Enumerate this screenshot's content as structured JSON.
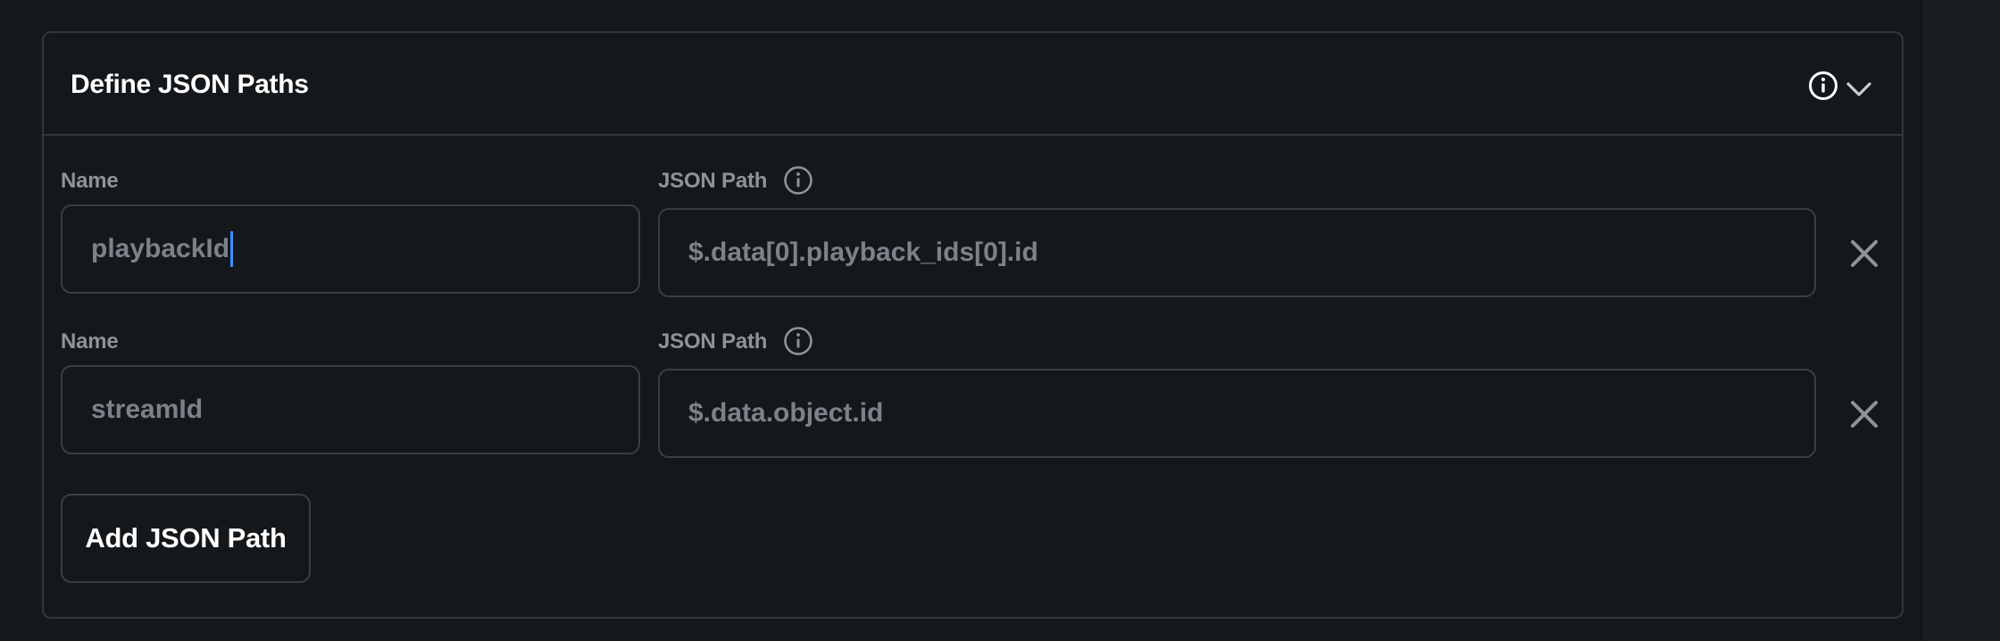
{
  "panel": {
    "title": "Define JSON Paths"
  },
  "rows": [
    {
      "name_label": "Name",
      "name_value": "playbackId",
      "path_label": "JSON Path",
      "path_value": "$.data[0].playback_ids[0].id"
    },
    {
      "name_label": "Name",
      "name_value": "streamId",
      "path_label": "JSON Path",
      "path_value": "$.data.object.id"
    }
  ],
  "add_button_label": "Add JSON Path",
  "icons": {
    "header_info": "info-icon",
    "header_chevron": "chevron-down-icon",
    "label_info": "info-icon",
    "remove": "close-icon"
  },
  "colors": {
    "background": "#15181b",
    "border": "#33373c",
    "title": "#ffffff",
    "label": "#8d939a",
    "input_text": "#7c828a",
    "caret": "#3d8bfd"
  }
}
